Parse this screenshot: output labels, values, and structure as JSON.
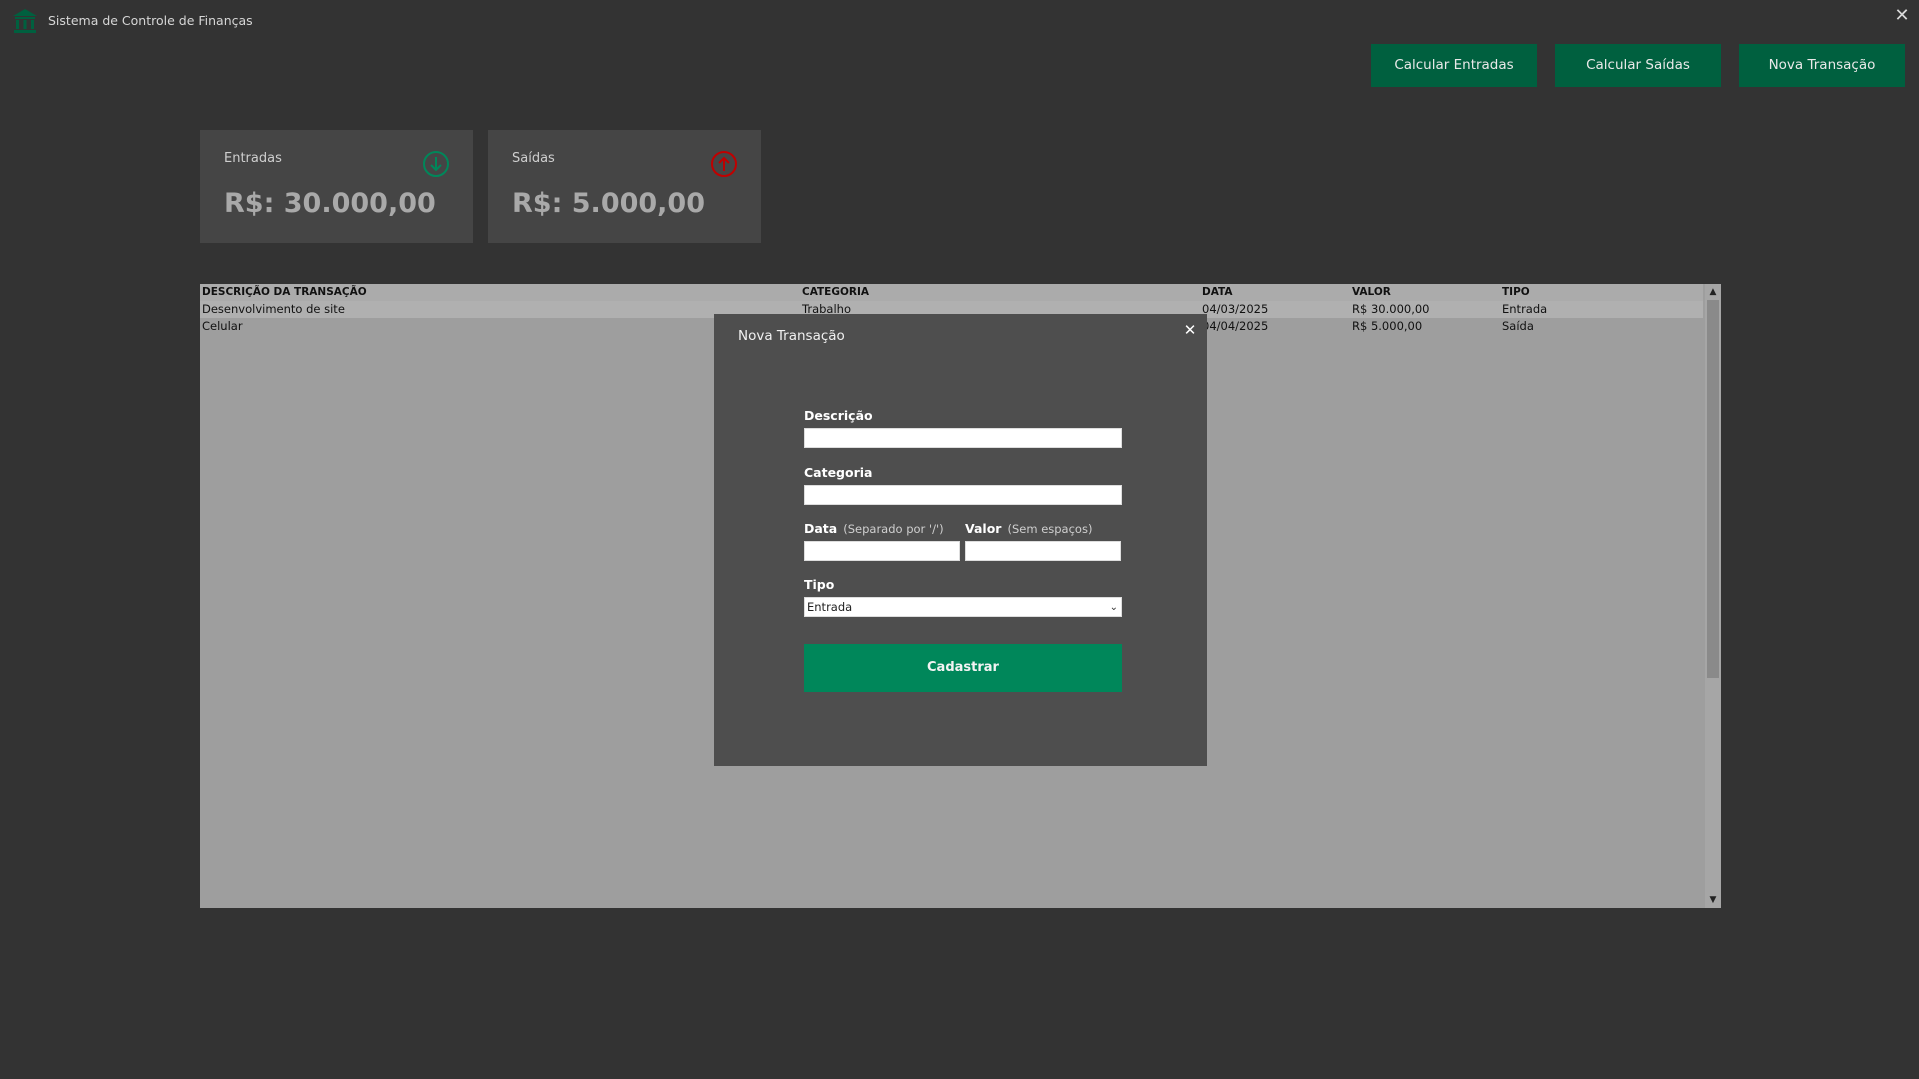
{
  "app": {
    "title": "Sistema de Controle de Finanças",
    "close_symbol": "✕"
  },
  "toolbar": {
    "calc_entradas": "Calcular Entradas",
    "calc_saidas": "Calcular Saídas",
    "nova_transacao": "Nova Transação"
  },
  "cards": {
    "entradas": {
      "label": "Entradas",
      "value": "R$: 30.000,00",
      "icon": "arrow-down-circle-icon",
      "color": "#00875a"
    },
    "saidas": {
      "label": "Saídas",
      "value": "R$: 5.000,00",
      "icon": "arrow-up-circle-icon",
      "color": "#c00000"
    }
  },
  "table": {
    "headers": {
      "descricao": "DESCRIÇÃO DA TRANSAÇÃO",
      "categoria": "CATEGORIA",
      "data": "DATA",
      "valor": "VALOR",
      "tipo": "TIPO"
    },
    "rows": [
      {
        "descricao": "Desenvolvimento de site",
        "categoria": "Trabalho",
        "data": "04/03/2025",
        "valor": "R$ 30.000,00",
        "tipo": "Entrada"
      },
      {
        "descricao": "Celular",
        "categoria": "",
        "data": "04/04/2025",
        "valor": "R$ 5.000,00",
        "tipo": "Saída"
      }
    ]
  },
  "modal": {
    "title": "Nova Transação",
    "close_symbol": "✕",
    "descricao_label": "Descrição",
    "descricao_value": "",
    "categoria_label": "Categoria",
    "categoria_value": "",
    "data_label": "Data",
    "data_hint": "(Separado por '/')",
    "data_value": "",
    "valor_label": "Valor",
    "valor_hint": "(Sem espaços)",
    "valor_value": "",
    "tipo_label": "Tipo",
    "tipo_selected": "Entrada",
    "submit": "Cadastrar"
  },
  "colors": {
    "background": "#333333",
    "button": "#00603f",
    "submit": "#00875a"
  }
}
